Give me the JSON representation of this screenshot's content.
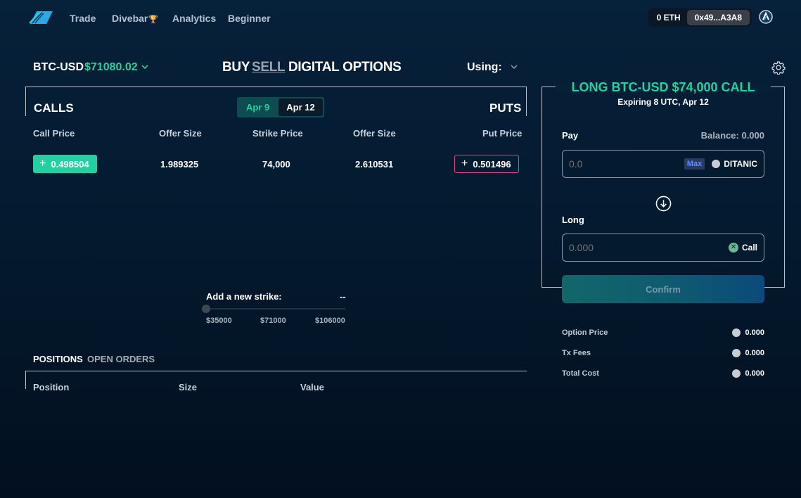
{
  "nav": {
    "items": [
      "Trade",
      "Divebar",
      "Analytics",
      "Beginner"
    ],
    "trophy": "🏆"
  },
  "wallet": {
    "balance": "0 ETH",
    "address": "0x49...A3A8"
  },
  "header": {
    "pair": "BTC-USD",
    "price": "$71080.02",
    "buy": "BUY",
    "sell": "SELL",
    "digital": "DIGITAL OPTIONS",
    "using": "Using:"
  },
  "table": {
    "calls": "CALLS",
    "puts": "PUTS",
    "dates": [
      "Apr 9",
      "Apr 12"
    ],
    "columns": [
      "Call Price",
      "Offer Size",
      "Strike Price",
      "Offer Size",
      "Put Price"
    ],
    "row": {
      "call_price": "0.498504",
      "call_offer": "1.989325",
      "strike": "74,000",
      "put_offer": "2.610531",
      "put_price": "0.501496"
    }
  },
  "strike": {
    "label": "Add a new strike:",
    "value": "--",
    "ticks": [
      "$35000",
      "$71000",
      "$106000"
    ]
  },
  "positions": {
    "tabs": [
      "POSITIONS",
      "OPEN ORDERS"
    ],
    "columns": [
      "Position",
      "Size",
      "Value"
    ]
  },
  "order": {
    "title": "LONG BTC-USD $74,000 CALL",
    "subtitle": "Expiring 8 UTC, Apr 12",
    "pay_label": "Pay",
    "balance": "Balance: 0.000",
    "pay_placeholder": "0.0",
    "max": "Max",
    "pay_token": "DITANIC",
    "long_label": "Long",
    "long_placeholder": "0.000",
    "long_token": "Call",
    "confirm": "Confirm"
  },
  "summary": [
    {
      "label": "Option Price",
      "value": "0.000"
    },
    {
      "label": "Tx Fees",
      "value": "0.000"
    },
    {
      "label": "Total Cost",
      "value": "0.000"
    }
  ],
  "colors": {
    "accent_green": "#22d3a0",
    "put_border": "#e2457f",
    "max_blue": "#5d8ef5"
  }
}
